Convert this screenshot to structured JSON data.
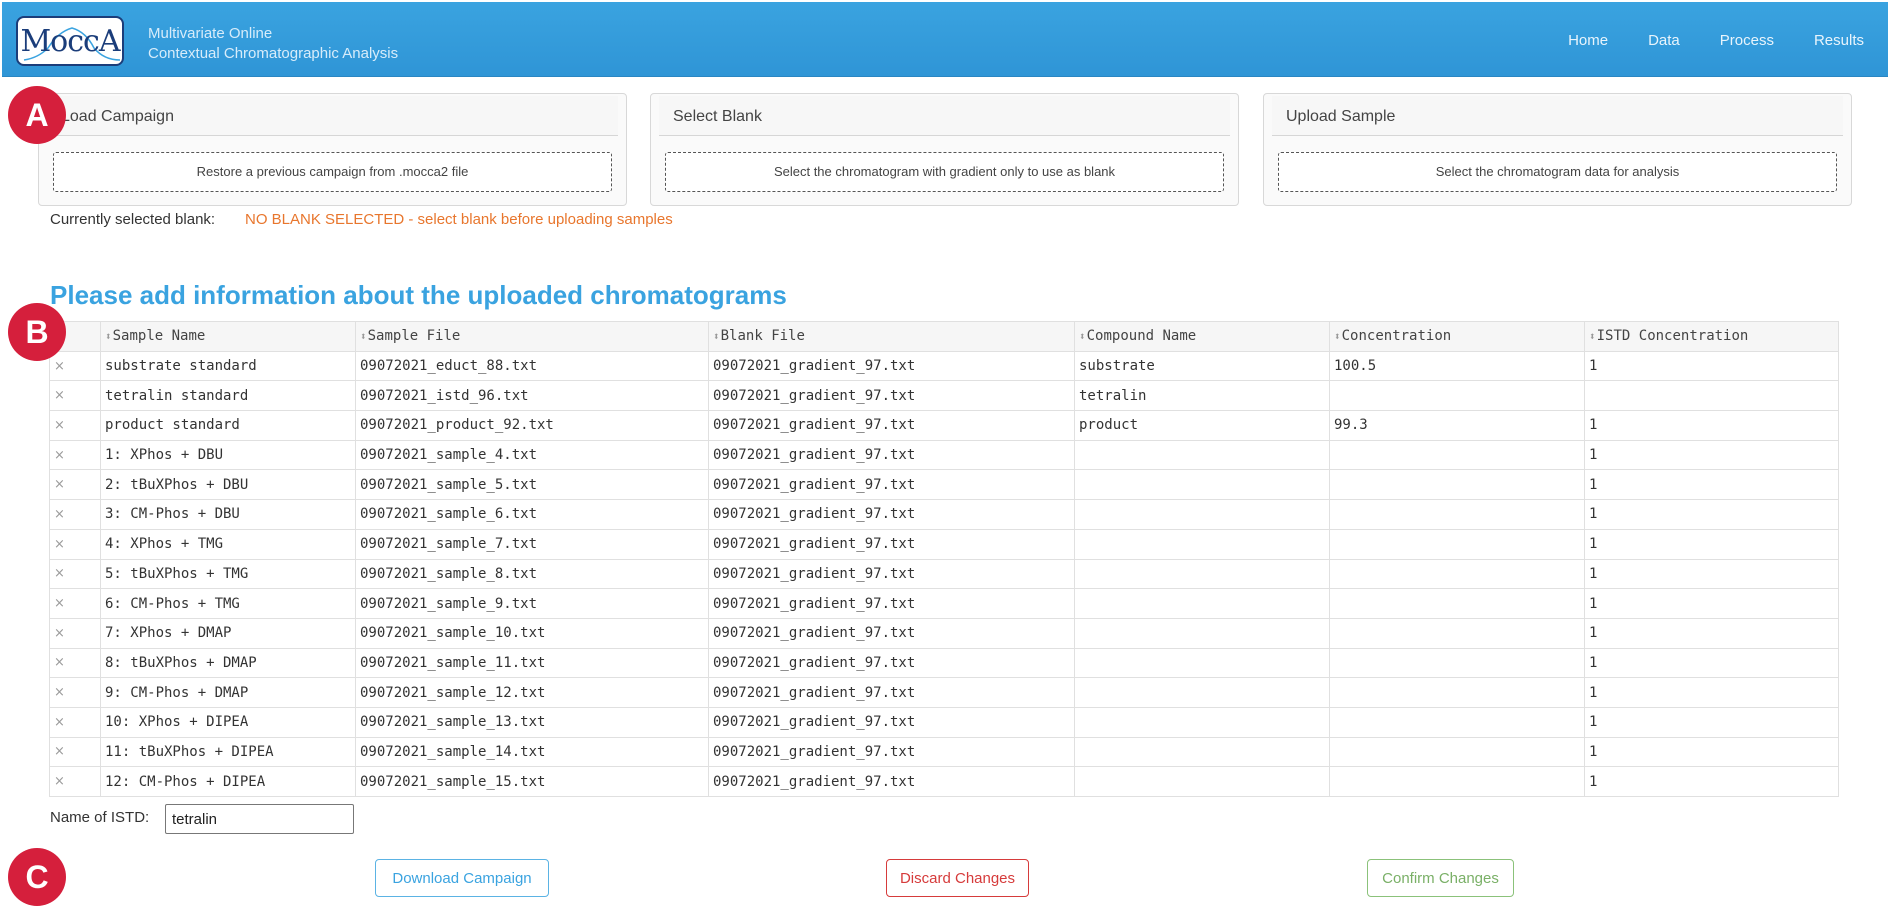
{
  "app": {
    "logo_text": "MoccA",
    "title_line1": "Multivariate Online",
    "title_line2": "Contextual Chromatographic Analysis"
  },
  "nav": {
    "items": [
      "Home",
      "Data",
      "Process",
      "Results"
    ]
  },
  "cards": [
    {
      "title": "Load Campaign",
      "drop_text": "Restore a previous campaign from .mocca2 file"
    },
    {
      "title": "Select Blank",
      "drop_text": "Select the chromatogram with gradient only to use as blank"
    },
    {
      "title": "Upload Sample",
      "drop_text": "Select the chromatogram data for analysis"
    }
  ],
  "blank_status": {
    "label": "Currently selected blank:",
    "value": "NO BLANK SELECTED - select blank before uploading samples"
  },
  "section_heading": "Please add information about the uploaded chromatograms",
  "table": {
    "columns": [
      "Sample Name",
      "Sample File",
      "Blank File",
      "Compound Name",
      "Concentration",
      "ISTD Concentration"
    ],
    "delete_symbol": "×",
    "sort_symbol": "⬍",
    "rows": [
      [
        "substrate standard",
        "09072021_educt_88.txt",
        "09072021_gradient_97.txt",
        "substrate",
        "100.5",
        "1"
      ],
      [
        "tetralin standard",
        "09072021_istd_96.txt",
        "09072021_gradient_97.txt",
        "tetralin",
        "",
        ""
      ],
      [
        "product standard",
        "09072021_product_92.txt",
        "09072021_gradient_97.txt",
        "product",
        "99.3",
        "1"
      ],
      [
        "1: XPhos + DBU",
        "09072021_sample_4.txt",
        "09072021_gradient_97.txt",
        "",
        "",
        "1"
      ],
      [
        "2: tBuXPhos + DBU",
        "09072021_sample_5.txt",
        "09072021_gradient_97.txt",
        "",
        "",
        "1"
      ],
      [
        "3: CM-Phos + DBU",
        "09072021_sample_6.txt",
        "09072021_gradient_97.txt",
        "",
        "",
        "1"
      ],
      [
        "4: XPhos + TMG",
        "09072021_sample_7.txt",
        "09072021_gradient_97.txt",
        "",
        "",
        "1"
      ],
      [
        "5: tBuXPhos + TMG",
        "09072021_sample_8.txt",
        "09072021_gradient_97.txt",
        "",
        "",
        "1"
      ],
      [
        "6: CM-Phos + TMG",
        "09072021_sample_9.txt",
        "09072021_gradient_97.txt",
        "",
        "",
        "1"
      ],
      [
        "7: XPhos + DMAP",
        "09072021_sample_10.txt",
        "09072021_gradient_97.txt",
        "",
        "",
        "1"
      ],
      [
        "8: tBuXPhos + DMAP",
        "09072021_sample_11.txt",
        "09072021_gradient_97.txt",
        "",
        "",
        "1"
      ],
      [
        "9: CM-Phos + DMAP",
        "09072021_sample_12.txt",
        "09072021_gradient_97.txt",
        "",
        "",
        "1"
      ],
      [
        "10: XPhos + DIPEA",
        "09072021_sample_13.txt",
        "09072021_gradient_97.txt",
        "",
        "",
        "1"
      ],
      [
        "11: tBuXPhos + DIPEA",
        "09072021_sample_14.txt",
        "09072021_gradient_97.txt",
        "",
        "",
        "1"
      ],
      [
        "12: CM-Phos + DIPEA",
        "09072021_sample_15.txt",
        "09072021_gradient_97.txt",
        "",
        "",
        "1"
      ]
    ]
  },
  "istd": {
    "label": "Name of ISTD:",
    "value": "tetralin"
  },
  "buttons": {
    "download": "Download Campaign",
    "discard": "Discard Changes",
    "confirm": "Confirm Changes"
  },
  "markers": [
    "A",
    "B",
    "C"
  ],
  "colors": {
    "navbar": "#3aa3e0",
    "warning": "#e8762d",
    "heading": "#3aa3e0",
    "marker": "#d51f3c"
  }
}
